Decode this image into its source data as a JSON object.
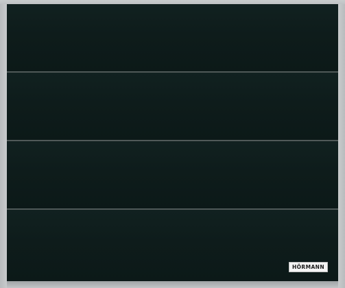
{
  "image": {
    "subject": "garage-door",
    "panel_count": 4,
    "colors": {
      "door": "#0d1a19",
      "frame": "#c6c9cb",
      "groove": "#6c7574",
      "logo_background": "#f4f4f4"
    }
  },
  "logo": {
    "brand": "HÖRMANN"
  }
}
